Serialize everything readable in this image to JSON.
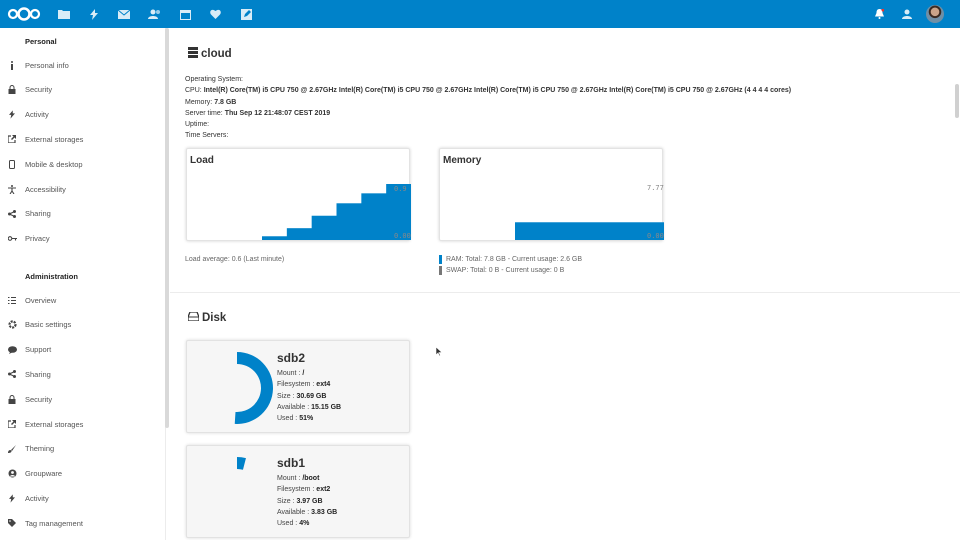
{
  "header": {
    "apps": [
      {
        "name": "logo",
        "icon": "nextcloud-logo"
      },
      {
        "name": "files",
        "icon": "folder-icon"
      },
      {
        "name": "activity",
        "icon": "lightning-icon"
      },
      {
        "name": "mail",
        "icon": "mail-icon"
      },
      {
        "name": "contacts",
        "icon": "contacts-icon"
      },
      {
        "name": "calendar",
        "icon": "calendar-icon"
      },
      {
        "name": "favorites",
        "icon": "heart-icon"
      },
      {
        "name": "notes",
        "icon": "edit-icon"
      }
    ],
    "right_icons": [
      "notifications-icon",
      "contacts-menu-icon",
      "avatar"
    ],
    "accent": "#0082c9"
  },
  "sidebar": {
    "personal_title": "Personal",
    "personal": [
      {
        "label": "Personal info",
        "icon": "info-icon"
      },
      {
        "label": "Security",
        "icon": "lock-icon"
      },
      {
        "label": "Activity",
        "icon": "lightning-icon"
      },
      {
        "label": "External storages",
        "icon": "external-link-icon"
      },
      {
        "label": "Mobile & desktop",
        "icon": "phone-icon"
      },
      {
        "label": "Accessibility",
        "icon": "accessibility-icon"
      },
      {
        "label": "Sharing",
        "icon": "share-icon"
      },
      {
        "label": "Privacy",
        "icon": "key-icon"
      }
    ],
    "admin_title": "Administration",
    "admin": [
      {
        "label": "Overview",
        "icon": "list-icon"
      },
      {
        "label": "Basic settings",
        "icon": "gear-icon"
      },
      {
        "label": "Support",
        "icon": "chat-icon"
      },
      {
        "label": "Sharing",
        "icon": "share-icon"
      },
      {
        "label": "Security",
        "icon": "lock-icon"
      },
      {
        "label": "External storages",
        "icon": "external-link-icon"
      },
      {
        "label": "Theming",
        "icon": "brush-icon"
      },
      {
        "label": "Groupware",
        "icon": "groupware-icon"
      },
      {
        "label": "Activity",
        "icon": "lightning-icon"
      },
      {
        "label": "Tag management",
        "icon": "tag-icon"
      }
    ]
  },
  "system": {
    "title": "cloud",
    "os_label": "Operating System:",
    "os_value": "",
    "cpu_label": "CPU:",
    "cpu_value": "Intel(R) Core(TM) i5 CPU 750 @ 2.67GHz Intel(R) Core(TM) i5 CPU 750 @ 2.67GHz Intel(R) Core(TM) i5 CPU 750 @ 2.67GHz Intel(R) Core(TM) i5 CPU 750 @ 2.67GHz (4 4 4 4 cores)",
    "memory_label": "Memory:",
    "memory_value": "7.8 GB",
    "server_time_label": "Server time:",
    "server_time_value": "Thu Sep 12 21:48:07 CEST 2019",
    "uptime_label": "Uptime:",
    "uptime_value": "",
    "time_servers_label": "Time Servers:",
    "time_servers_value": ""
  },
  "load": {
    "title": "Load",
    "max_label": "0.9",
    "min_label": "0.00",
    "average_text": "Load average: 0.6 (Last minute)",
    "color": "#0082c9"
  },
  "memory": {
    "title": "Memory",
    "max_label": "7.77",
    "min_label": "0.00",
    "ram_text": "RAM: Total: 7.8 GB - Current usage: 2.6 GB",
    "swap_text": "SWAP: Total: 0 B - Current usage: 0 B",
    "ram_color": "#0082c9",
    "swap_color": "#777777"
  },
  "chart_data": [
    {
      "type": "area",
      "title": "Load",
      "x": [
        1,
        2,
        3,
        4,
        5,
        6
      ],
      "values": [
        0.06,
        0.19,
        0.39,
        0.59,
        0.75,
        0.9
      ],
      "ylim": [
        0,
        0.9
      ],
      "xlabel": "",
      "ylabel": ""
    },
    {
      "type": "area",
      "title": "Memory",
      "x": [
        1,
        2
      ],
      "values": [
        2.6,
        2.6
      ],
      "ylim": [
        0,
        7.77
      ],
      "xlabel": "",
      "ylabel": ""
    }
  ],
  "disk": {
    "title": "Disk",
    "labels": {
      "mount": "Mount :",
      "fs": "Filesystem :",
      "size": "Size :",
      "available": "Available :",
      "used": "Used :"
    },
    "disks": [
      {
        "name": "sdb2",
        "mount": "/",
        "fs": "ext4",
        "size": "30.69 GB",
        "available": "15.15 GB",
        "used": "51%",
        "used_fraction": 0.51
      },
      {
        "name": "sdb1",
        "mount": "/boot",
        "fs": "ext2",
        "size": "3.97 GB",
        "available": "3.83 GB",
        "used": "4%",
        "used_fraction": 0.04
      }
    ],
    "color": "#0082c9"
  }
}
